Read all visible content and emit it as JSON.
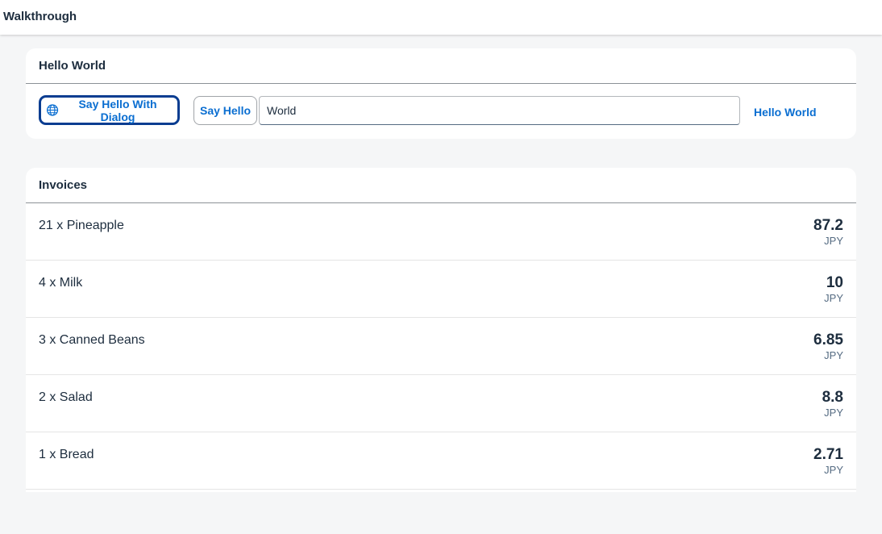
{
  "app": {
    "title": "Walkthrough"
  },
  "hello_panel": {
    "title": "Hello World",
    "dialog_button_label": "Say Hello With Dialog",
    "hello_button_label": "Say Hello",
    "name_input_value": "World",
    "greeting_text": "Hello World"
  },
  "invoices": {
    "title": "Invoices",
    "items": [
      {
        "label": "21 x Pineapple",
        "amount": "87.2",
        "currency": "JPY"
      },
      {
        "label": "4 x Milk",
        "amount": "10",
        "currency": "JPY"
      },
      {
        "label": "3 x Canned Beans",
        "amount": "6.85",
        "currency": "JPY"
      },
      {
        "label": "2 x Salad",
        "amount": "8.8",
        "currency": "JPY"
      },
      {
        "label": "1 x Bread",
        "amount": "2.71",
        "currency": "JPY"
      }
    ]
  },
  "colors": {
    "accent": "#0a6ed1",
    "text": "#1d2d3e",
    "background": "#f5f6f7"
  }
}
